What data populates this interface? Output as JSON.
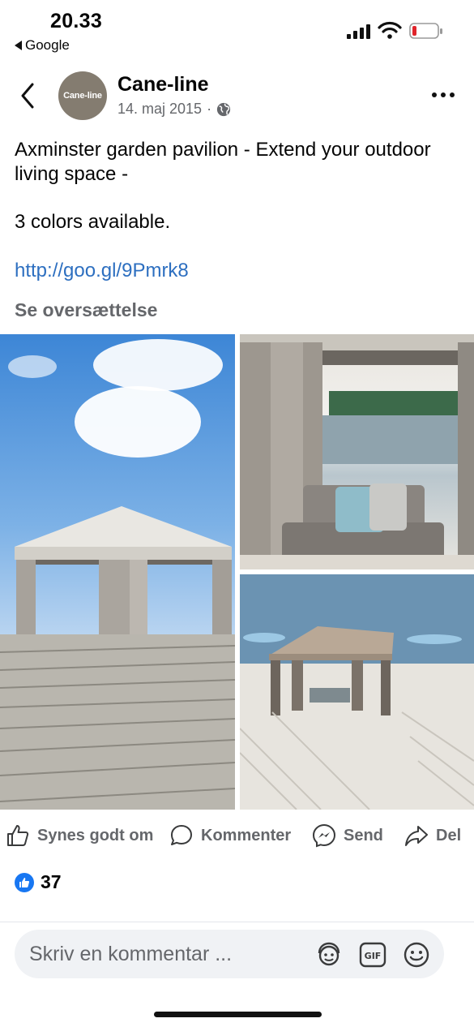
{
  "status_bar": {
    "time": "20.33",
    "back_app": "Google"
  },
  "post": {
    "author": "Cane-line",
    "avatar_text": "Cane-line",
    "date": "14. maj 2015",
    "meta_separator": "·",
    "text_line_1": "Axminster garden pavilion - Extend your outdoor living space -",
    "text_line_2": "3 colors available.",
    "link": "http://goo.gl/9Pmrk8",
    "translate": "Se oversættelse"
  },
  "actions": {
    "like": "Synes godt om",
    "comment": "Kommenter",
    "send": "Send",
    "share": "Del"
  },
  "reactions": {
    "like_count": "37"
  },
  "comment_bar": {
    "placeholder": "Skriv en kommentar ..."
  },
  "icons": {
    "back": "chevron-left-icon",
    "globe": "globe-icon",
    "more": "more-horizontal-icon",
    "like": "thumbs-up-icon",
    "comment": "speech-bubble-icon",
    "send": "messenger-icon",
    "share": "share-arrow-icon",
    "avatar_sticker": "avatar-sticker-icon",
    "gif": "gif-icon",
    "emoji": "emoji-icon"
  },
  "colors": {
    "link": "#2d6fc0",
    "like_blue": "#1877f2",
    "secondary_text": "#65676b",
    "battery_low": "#e0242b"
  }
}
